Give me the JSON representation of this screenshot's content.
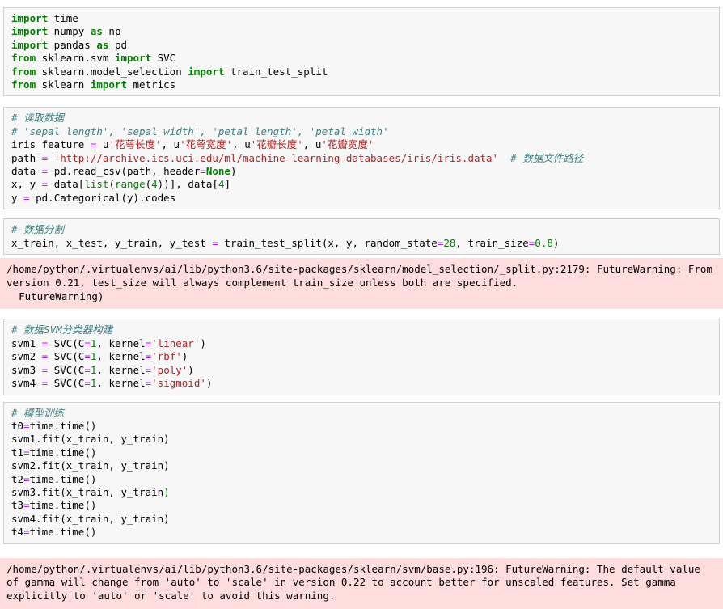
{
  "notebook": {
    "cells": [
      {
        "type": "code",
        "name": "cell-imports",
        "lines": [
          [
            {
              "t": "import",
              "c": "kw"
            },
            {
              "t": " time",
              "c": "nm"
            }
          ],
          [
            {
              "t": "import",
              "c": "kw"
            },
            {
              "t": " numpy ",
              "c": "nm"
            },
            {
              "t": "as",
              "c": "kw"
            },
            {
              "t": " np",
              "c": "nm"
            }
          ],
          [
            {
              "t": "import",
              "c": "kw"
            },
            {
              "t": " pandas ",
              "c": "nm"
            },
            {
              "t": "as",
              "c": "kw"
            },
            {
              "t": " pd",
              "c": "nm"
            }
          ],
          [
            {
              "t": "from",
              "c": "kw"
            },
            {
              "t": " sklearn.svm ",
              "c": "nm"
            },
            {
              "t": "import",
              "c": "kw"
            },
            {
              "t": " SVC",
              "c": "nm"
            }
          ],
          [
            {
              "t": "from",
              "c": "kw"
            },
            {
              "t": " sklearn.model_selection ",
              "c": "nm"
            },
            {
              "t": "import",
              "c": "kw"
            },
            {
              "t": " train_test_split",
              "c": "nm"
            }
          ],
          [
            {
              "t": "from",
              "c": "kw"
            },
            {
              "t": " sklearn ",
              "c": "nm"
            },
            {
              "t": "import",
              "c": "kw"
            },
            {
              "t": " metrics",
              "c": "nm"
            }
          ]
        ]
      },
      {
        "type": "code",
        "name": "cell-read-data",
        "lines": [
          [
            {
              "t": "# 读取数据",
              "c": "cm"
            }
          ],
          [
            {
              "t": "# 'sepal length', 'sepal width', 'petal length', 'petal width'",
              "c": "cm"
            }
          ],
          [
            {
              "t": "iris_feature ",
              "c": "nm"
            },
            {
              "t": "=",
              "c": "op"
            },
            {
              "t": " u",
              "c": "nm"
            },
            {
              "t": "'花萼长度'",
              "c": "str"
            },
            {
              "t": ", u",
              "c": "nm"
            },
            {
              "t": "'花萼宽度'",
              "c": "str"
            },
            {
              "t": ", u",
              "c": "nm"
            },
            {
              "t": "'花瓣长度'",
              "c": "str"
            },
            {
              "t": ", u",
              "c": "nm"
            },
            {
              "t": "'花瓣宽度'",
              "c": "str"
            }
          ],
          [
            {
              "t": "path ",
              "c": "nm"
            },
            {
              "t": "=",
              "c": "op"
            },
            {
              "t": " ",
              "c": "nm"
            },
            {
              "t": "'http://archive.ics.uci.edu/ml/machine-learning-databases/iris/iris.data'",
              "c": "str"
            },
            {
              "t": "  ",
              "c": "nm"
            },
            {
              "t": "# 数据文件路径",
              "c": "cm"
            }
          ],
          [
            {
              "t": "data ",
              "c": "nm"
            },
            {
              "t": "=",
              "c": "op"
            },
            {
              "t": " pd.read_csv(path, header",
              "c": "nm"
            },
            {
              "t": "=",
              "c": "op"
            },
            {
              "t": "None",
              "c": "kw"
            },
            {
              "t": ")",
              "c": "nm"
            }
          ],
          [
            {
              "t": "x, y ",
              "c": "nm"
            },
            {
              "t": "=",
              "c": "op"
            },
            {
              "t": " data[",
              "c": "nm"
            },
            {
              "t": "list",
              "c": "bi"
            },
            {
              "t": "(",
              "c": "nm"
            },
            {
              "t": "range",
              "c": "bi"
            },
            {
              "t": "(",
              "c": "nm"
            },
            {
              "t": "4",
              "c": "num"
            },
            {
              "t": "))], data[",
              "c": "nm"
            },
            {
              "t": "4",
              "c": "num"
            },
            {
              "t": "]",
              "c": "nm"
            }
          ],
          [
            {
              "t": "y ",
              "c": "nm"
            },
            {
              "t": "=",
              "c": "op"
            },
            {
              "t": " pd.Categorical(y).codes",
              "c": "nm"
            }
          ]
        ]
      },
      {
        "type": "code",
        "name": "cell-split-data",
        "lines": [
          [
            {
              "t": "# 数据分割",
              "c": "cm"
            }
          ],
          [
            {
              "t": "x_train, x_test, y_train, y_test ",
              "c": "nm"
            },
            {
              "t": "=",
              "c": "op"
            },
            {
              "t": " train_test_split(x, y, random_state",
              "c": "nm"
            },
            {
              "t": "=",
              "c": "op"
            },
            {
              "t": "28",
              "c": "num"
            },
            {
              "t": ", train_size",
              "c": "nm"
            },
            {
              "t": "=",
              "c": "op"
            },
            {
              "t": "0.8",
              "c": "num"
            },
            {
              "t": ")",
              "c": "nm"
            }
          ]
        ]
      },
      {
        "type": "stderr",
        "name": "output-futurewarning-split",
        "lines": [
          "/home/python/.virtualenvs/ai/lib/python3.6/site-packages/sklearn/model_selection/_split.py:2179: FutureWarning: From version 0.21, test_size will always complement train_size unless both are specified.",
          "  FutureWarning)"
        ]
      },
      {
        "type": "code",
        "name": "cell-build-svm",
        "lines": [
          [
            {
              "t": "# 数据SVM分类器构建",
              "c": "cm"
            }
          ],
          [
            {
              "t": "svm1 ",
              "c": "nm"
            },
            {
              "t": "=",
              "c": "op"
            },
            {
              "t": " SVC(C",
              "c": "nm"
            },
            {
              "t": "=",
              "c": "op"
            },
            {
              "t": "1",
              "c": "num"
            },
            {
              "t": ", kernel",
              "c": "nm"
            },
            {
              "t": "=",
              "c": "op"
            },
            {
              "t": "'linear'",
              "c": "str"
            },
            {
              "t": ")",
              "c": "nm"
            }
          ],
          [
            {
              "t": "svm2 ",
              "c": "nm"
            },
            {
              "t": "=",
              "c": "op"
            },
            {
              "t": " SVC(C",
              "c": "nm"
            },
            {
              "t": "=",
              "c": "op"
            },
            {
              "t": "1",
              "c": "num"
            },
            {
              "t": ", kernel",
              "c": "nm"
            },
            {
              "t": "=",
              "c": "op"
            },
            {
              "t": "'rbf'",
              "c": "str"
            },
            {
              "t": ")",
              "c": "nm"
            }
          ],
          [
            {
              "t": "svm3 ",
              "c": "nm"
            },
            {
              "t": "=",
              "c": "op"
            },
            {
              "t": " SVC(C",
              "c": "nm"
            },
            {
              "t": "=",
              "c": "op"
            },
            {
              "t": "1",
              "c": "num"
            },
            {
              "t": ", kernel",
              "c": "nm"
            },
            {
              "t": "=",
              "c": "op"
            },
            {
              "t": "'poly'",
              "c": "str"
            },
            {
              "t": ")",
              "c": "nm"
            }
          ],
          [
            {
              "t": "svm4 ",
              "c": "nm"
            },
            {
              "t": "=",
              "c": "op"
            },
            {
              "t": " SVC(C",
              "c": "nm"
            },
            {
              "t": "=",
              "c": "op"
            },
            {
              "t": "1",
              "c": "num"
            },
            {
              "t": ", kernel",
              "c": "nm"
            },
            {
              "t": "=",
              "c": "op"
            },
            {
              "t": "'sigmoid'",
              "c": "str"
            },
            {
              "t": ")",
              "c": "nm"
            }
          ]
        ]
      },
      {
        "type": "code",
        "name": "cell-train-model",
        "lines": [
          [
            {
              "t": "# 模型训练",
              "c": "cm"
            }
          ],
          [
            {
              "t": "t0",
              "c": "nm"
            },
            {
              "t": "=",
              "c": "op"
            },
            {
              "t": "time.time()",
              "c": "nm"
            }
          ],
          [
            {
              "t": "svm1.fit(x_train, y_train)",
              "c": "nm"
            }
          ],
          [
            {
              "t": "t1",
              "c": "nm"
            },
            {
              "t": "=",
              "c": "op"
            },
            {
              "t": "time.time()",
              "c": "nm"
            }
          ],
          [
            {
              "t": "svm2.fit(x_train, y_train)",
              "c": "nm"
            }
          ],
          [
            {
              "t": "t2",
              "c": "nm"
            },
            {
              "t": "=",
              "c": "op"
            },
            {
              "t": "time.time()",
              "c": "nm"
            }
          ],
          [
            {
              "t": "svm3.fit(x_train, y_train",
              "c": "nm"
            },
            {
              "t": ")",
              "c": "grn-p"
            }
          ],
          [
            {
              "t": "t3",
              "c": "nm"
            },
            {
              "t": "=",
              "c": "op"
            },
            {
              "t": "time.time()",
              "c": "nm"
            }
          ],
          [
            {
              "t": "svm4.fit(x_train, y_train)",
              "c": "nm"
            }
          ],
          [
            {
              "t": "t4",
              "c": "nm"
            },
            {
              "t": "=",
              "c": "op"
            },
            {
              "t": "time.time()",
              "c": "nm"
            }
          ]
        ]
      },
      {
        "type": "stderr",
        "name": "output-futurewarning-gamma",
        "lines": [
          "/home/python/.virtualenvs/ai/lib/python3.6/site-packages/sklearn/svm/base.py:196: FutureWarning: The default value of gamma will change from 'auto' to 'scale' in version 0.22 to account better for unscaled features. Set gamma explicitly to 'auto' or 'scale' to avoid this warning."
        ]
      }
    ]
  },
  "colors": {
    "cell_background": "#f7f7f7",
    "cell_border": "#cfcfcf",
    "stderr_background": "#ffdddd",
    "keyword": "#008000",
    "string": "#ba2121",
    "operator": "#aa22ff",
    "number": "#008000",
    "comment": "#408080"
  }
}
